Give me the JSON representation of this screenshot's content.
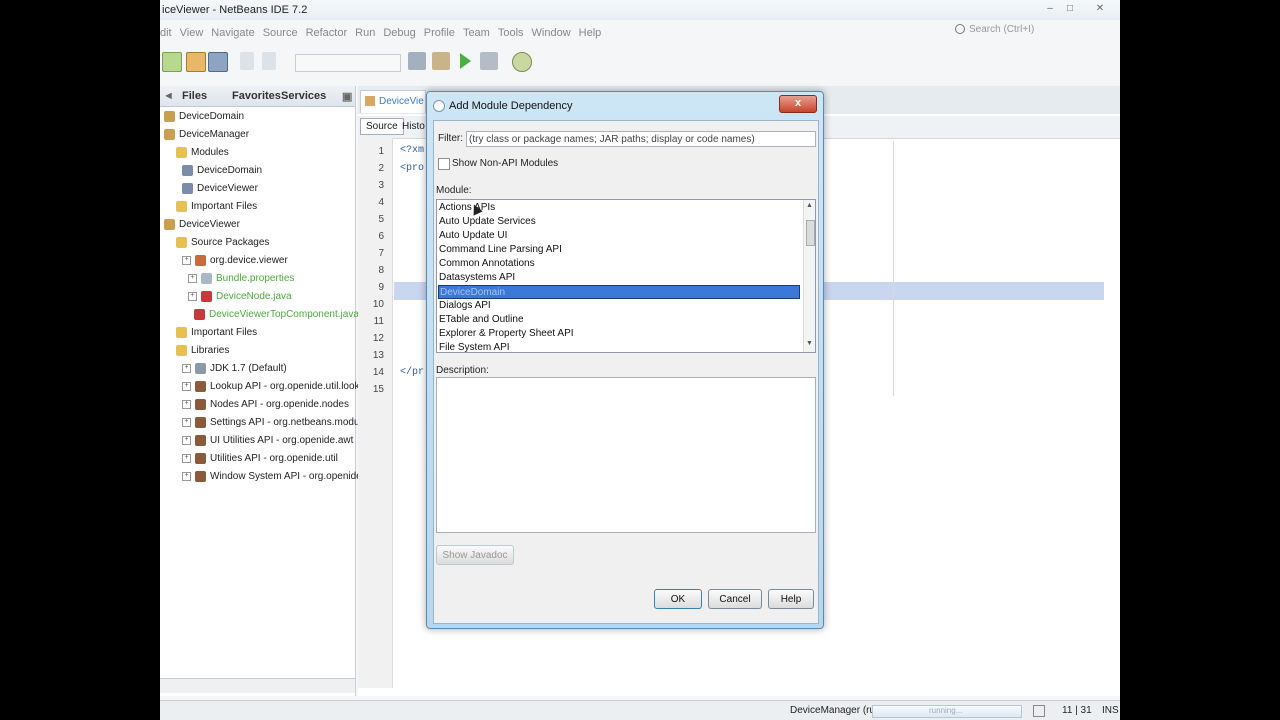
{
  "window": {
    "title": "iceViewer - NetBeans IDE 7.2"
  },
  "menu": [
    "dit",
    "View",
    "Navigate",
    "Source",
    "Refactor",
    "Run",
    "Debug",
    "Profile",
    "Team",
    "Tools",
    "Window",
    "Help"
  ],
  "search": {
    "placeholder": "Search (Ctrl+I)"
  },
  "panel_tabs": [
    "Files",
    "Favorites",
    "Services"
  ],
  "tree": [
    {
      "label": "DeviceDomain",
      "icon": "project-icon"
    },
    {
      "label": "DeviceManager",
      "icon": "project-icon"
    },
    {
      "label": "Modules",
      "icon": "folder-icon"
    },
    {
      "label": "DeviceDomain",
      "icon": "module-icon"
    },
    {
      "label": "DeviceViewer",
      "icon": "module-icon"
    },
    {
      "label": "Important Files",
      "icon": "folder-icon"
    },
    {
      "label": "DeviceViewer",
      "icon": "project-icon"
    },
    {
      "label": "Source Packages",
      "icon": "folder-icon"
    },
    {
      "label": "org.device.viewer",
      "icon": "package-icon"
    },
    {
      "label": "Bundle.properties",
      "icon": "file-icon"
    },
    {
      "label": "DeviceNode.java",
      "icon": "java-file-icon"
    },
    {
      "label": "DeviceViewerTopComponent.java",
      "icon": "java-file-icon"
    },
    {
      "label": "Important Files",
      "icon": "folder-icon"
    },
    {
      "label": "Libraries",
      "icon": "library-folder-icon"
    },
    {
      "label": "JDK 1.7 (Default)",
      "icon": "jdk-icon"
    },
    {
      "label": "Lookup API - org.openide.util.lookup",
      "icon": "jar-icon"
    },
    {
      "label": "Nodes API - org.openide.nodes",
      "icon": "jar-icon"
    },
    {
      "label": "Settings API - org.netbeans.modules.setti",
      "icon": "jar-icon"
    },
    {
      "label": "UI Utilities API - org.openide.awt",
      "icon": "jar-icon"
    },
    {
      "label": "Utilities API - org.openide.util",
      "icon": "jar-icon"
    },
    {
      "label": "Window System API - org.openide.window",
      "icon": "jar-icon"
    }
  ],
  "editor": {
    "tab_label": "DeviceVie",
    "source_tab": "Source",
    "history_tab": "Histo",
    "line_numbers": [
      "1",
      "2",
      "3",
      "4",
      "5",
      "6",
      "7",
      "8",
      "9",
      "10",
      "11",
      "12",
      "13",
      "14",
      "15"
    ],
    "code_line1": "<?xm",
    "code_line2": "<pro",
    "code_line14": "</pr"
  },
  "dialog": {
    "title": "Add Module Dependency",
    "close": "x",
    "filter_label": "Filter:",
    "filter_placeholder": "(try class or package names; JAR paths; display or code names)",
    "show_non_api": "Show Non-API Modules",
    "module_label": "Module:",
    "modules": [
      "Actions APIs",
      "Auto Update Services",
      "Auto Update UI",
      "Command Line Parsing API",
      "Common Annotations",
      "Datasystems API",
      "DeviceDomain",
      "Dialogs API",
      "ETable and Outline",
      "Explorer & Property Sheet API",
      "File System API"
    ],
    "selected_index": 6,
    "description_label": "Description:",
    "show_javadoc": "Show Javadoc",
    "ok": "OK",
    "cancel": "Cancel",
    "help": "Help"
  },
  "status": {
    "running": "DeviceManager (run)",
    "progress_text": "running...",
    "position": "11 | 31",
    "mode": "INS"
  }
}
